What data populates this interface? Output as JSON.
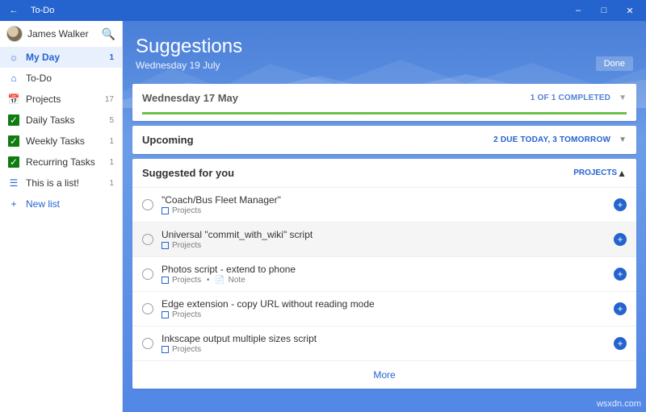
{
  "titlebar": {
    "app": "To-Do"
  },
  "profile": {
    "name": "James Walker"
  },
  "sidebar": {
    "items": [
      {
        "icon": "sun",
        "label": "My Day",
        "count": "1",
        "active": true
      },
      {
        "icon": "home",
        "label": "To-Do",
        "count": ""
      },
      {
        "icon": "cal",
        "label": "Projects",
        "count": "17"
      },
      {
        "icon": "check",
        "label": "Daily Tasks",
        "count": "5"
      },
      {
        "icon": "check",
        "label": "Weekly Tasks",
        "count": "1"
      },
      {
        "icon": "check",
        "label": "Recurring Tasks",
        "count": "1"
      },
      {
        "icon": "list",
        "label": "This is a list!",
        "count": "1"
      }
    ],
    "newlist": "New list"
  },
  "header": {
    "title": "Suggestions",
    "date": "Wednesday 19 July",
    "done": "Done"
  },
  "sections": {
    "past": {
      "title": "Wednesday 17 May",
      "meta": "1 OF 1 COMPLETED"
    },
    "upcoming": {
      "title": "Upcoming",
      "meta": "2 DUE TODAY, 3 TOMORROW"
    }
  },
  "suggest": {
    "title": "Suggested for you",
    "source": "PROJECTS",
    "items": [
      {
        "title": "\"Coach/Bus Fleet Manager\"",
        "sub": "Projects"
      },
      {
        "title": "Universal \"commit_with_wiki\" script",
        "sub": "Projects"
      },
      {
        "title": "Photos script - extend to phone",
        "sub": "Projects",
        "note": true
      },
      {
        "title": "Edge extension - copy URL without reading mode",
        "sub": "Projects"
      },
      {
        "title": "Inkscape output multiple sizes script",
        "sub": "Projects"
      }
    ],
    "more": "More",
    "noteLabel": "Note"
  },
  "watermark": "wsxdn.com"
}
